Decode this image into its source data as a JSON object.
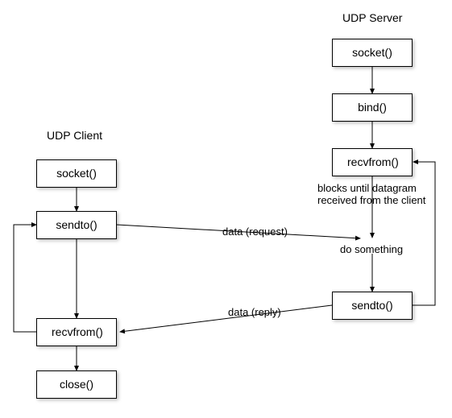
{
  "headings": {
    "client": "UDP Client",
    "server": "UDP Server"
  },
  "nodes": {
    "client_socket": "socket()",
    "client_sendto": "sendto()",
    "client_recvfrom": "recvfrom()",
    "client_close": "close()",
    "server_socket": "socket()",
    "server_bind": "bind()",
    "server_recvfrom": "recvfrom()",
    "server_sendto": "sendto()"
  },
  "labels": {
    "request": "data (request)",
    "reply": "data (reply)",
    "blocks": "blocks until datagram received from the client",
    "dosomething": "do something"
  }
}
